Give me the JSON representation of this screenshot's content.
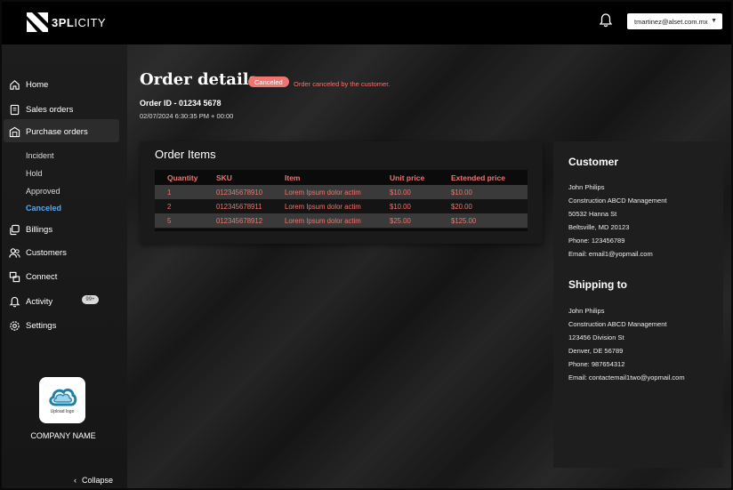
{
  "brand": {
    "name_bold": "3PL",
    "name_rest": "ICITY"
  },
  "header": {
    "user_email": "tmartinez@alset.com.mx"
  },
  "sidebar": {
    "items": [
      {
        "label": "Home",
        "icon": "home-icon"
      },
      {
        "label": "Sales orders",
        "icon": "document-icon"
      },
      {
        "label": "Purchase orders",
        "icon": "store-icon"
      },
      {
        "label": "Billings",
        "icon": "copy-icon"
      },
      {
        "label": "Customers",
        "icon": "users-icon"
      },
      {
        "label": "Connect",
        "icon": "connect-icon"
      },
      {
        "label": "Activity",
        "icon": "bell-icon"
      },
      {
        "label": "Settings",
        "icon": "gear-icon"
      }
    ],
    "sub_items": [
      {
        "label": "Incident"
      },
      {
        "label": "Hold"
      },
      {
        "label": "Approved"
      },
      {
        "label": "Canceled"
      }
    ],
    "activity_badge": "99+",
    "upload_logo_label": "Upload logo",
    "company_name": "COMPANY NAME",
    "collapse_label": "Collapse"
  },
  "order": {
    "title": "Order details",
    "status": "Canceled",
    "status_note": "Order canceled by the customer.",
    "order_id": "Order ID - 01234 5678",
    "date": "02/07/2024 6:30:35 PM + 00:00"
  },
  "items_panel": {
    "title": "Order Items",
    "columns": [
      "Quantity",
      "SKU",
      "Item",
      "Unit price",
      "Extended price"
    ],
    "rows": [
      [
        "1",
        "012345678910",
        "Lorem Ipsum dolor actim",
        "$10.00",
        "$10.00"
      ],
      [
        "2",
        "012345678911",
        "Lorem Ipsum dolor actim",
        "$10.00",
        "$20.00"
      ],
      [
        "5",
        "012345678912",
        "Lorem Ipsum dolor actim",
        "$25.00",
        "$125.00"
      ]
    ]
  },
  "customer": {
    "heading": "Customer",
    "lines": [
      "John Philips",
      "Construction ABCD Management",
      "50532 Hanna St",
      "Beltsville, MD 20123",
      "Phone: 123456789",
      "Email: email1@yopmail.com"
    ]
  },
  "shipping": {
    "heading": "Shipping to",
    "lines": [
      "John Philips",
      "Construction ABCD Management",
      "123456 Division St",
      "Denver, DE 56789",
      "Phone: 987654312",
      "Email: contactemail1two@yopmail.com"
    ]
  },
  "colors": {
    "accent_red": "#f07470",
    "selected_blue": "#5aa9f0"
  }
}
